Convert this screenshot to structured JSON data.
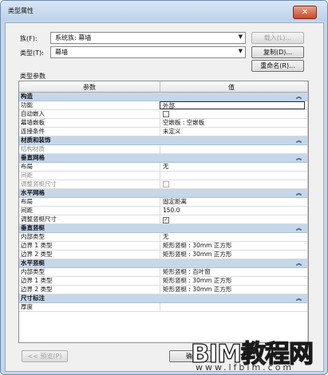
{
  "window": {
    "title": "类型属性",
    "close_glyph": "✕"
  },
  "family": {
    "label": "族(F):",
    "value": "系统族: 幕墙",
    "load_button": "载入(L)..."
  },
  "type": {
    "label": "类型(T):",
    "value": "幕墙",
    "duplicate_button": "复制(D)...",
    "rename_button": "重命名(R)..."
  },
  "type_params_label": "类型参数",
  "table": {
    "col_param": "参数",
    "col_value": "值",
    "groups": [
      {
        "title": "构造",
        "rows": [
          {
            "param": "功能",
            "value": "外部",
            "editing": true
          },
          {
            "param": "自动嵌入",
            "checkbox": true,
            "checked": false
          },
          {
            "param": "幕墙嵌板",
            "value": "空嵌板 : 空嵌板"
          },
          {
            "param": "连接条件",
            "value": "未定义"
          }
        ]
      },
      {
        "title": "材质和装饰",
        "rows": [
          {
            "param": "结构材质",
            "value": "",
            "gray": true
          }
        ]
      },
      {
        "title": "垂直网格",
        "rows": [
          {
            "param": "布局",
            "value": "无"
          },
          {
            "param": "间距",
            "value": "",
            "gray": true
          },
          {
            "param": "调整竖梃尺寸",
            "checkbox": true,
            "checked": false,
            "gray": true,
            "disabled": true
          }
        ]
      },
      {
        "title": "水平网格",
        "rows": [
          {
            "param": "布局",
            "value": "固定距离"
          },
          {
            "param": "间距",
            "value": "150.0"
          },
          {
            "param": "调整竖梃尺寸",
            "checkbox": true,
            "checked": true
          }
        ]
      },
      {
        "title": "垂直竖梃",
        "rows": [
          {
            "param": "内部类型",
            "value": "无"
          },
          {
            "param": "边界 1 类型",
            "value": "矩形竖梃 : 30mm 正方形"
          },
          {
            "param": "边界 2 类型",
            "value": "矩形竖梃 : 30mm 正方形"
          }
        ]
      },
      {
        "title": "水平竖梃",
        "rows": [
          {
            "param": "内部类型",
            "value": "矩形竖梃 : 百叶窗"
          },
          {
            "param": "边界 1 类型",
            "value": "矩形竖梃 : 30mm 正方形"
          },
          {
            "param": "边界 2 类型",
            "value": "矩形竖梃 : 30mm 正方形"
          }
        ]
      },
      {
        "title": "尺寸标注",
        "rows": [
          {
            "param": "厚度",
            "value": ""
          }
        ]
      }
    ]
  },
  "footer": {
    "preview_button": "<< 预览(P)",
    "ok_button": "确定"
  },
  "watermark": {
    "text": "BIM教程网",
    "url": "www.lfbim.com"
  },
  "colors": {
    "group_header": "#c7d7ea",
    "chrome": "#c4d6ea"
  }
}
